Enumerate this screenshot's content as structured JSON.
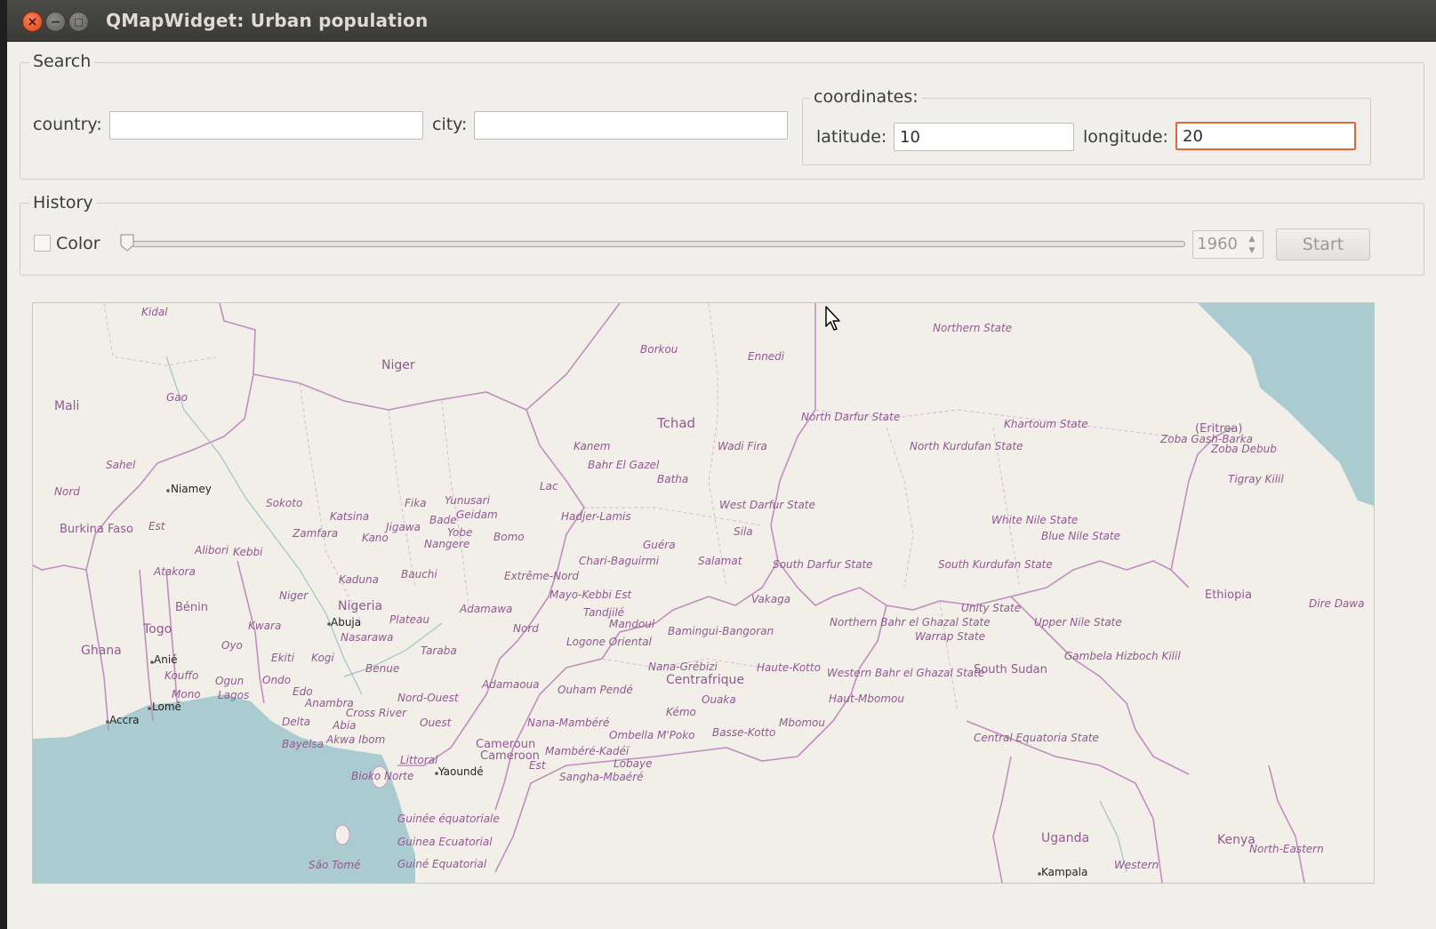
{
  "window": {
    "title": "QMapWidget: Urban population"
  },
  "search": {
    "group_title": "Search",
    "country_label": "country:",
    "country_value": "",
    "city_label": "city:",
    "city_value": "",
    "coordinates": {
      "group_title": "coordinates:",
      "latitude_label": "latitude:",
      "latitude_value": "10",
      "longitude_label": "longitude:",
      "longitude_value": "20"
    }
  },
  "history": {
    "group_title": "History",
    "color_label": "Color",
    "color_checked": false,
    "slider_fraction": 0,
    "year_value": "1960",
    "start_label": "Start"
  },
  "map": {
    "labels": [
      "Kidal",
      "Niger",
      "Borkou",
      "Ennedi",
      "Northern State",
      "Mali",
      "Gao",
      "Tchad",
      "North Darfur State",
      "Khartoum State",
      "Kanem",
      "Wadi Fira",
      "North Kurdufan State",
      "(Eritrea)",
      "Zoba Gash-Barka",
      "Zoba Debub",
      "Sahel",
      "Niamey",
      "Bahr El Gazel",
      "Batha",
      "Lac",
      "Tigray Kilil",
      "Nord",
      "Sokoto",
      "Katsina",
      "Fika",
      "Yunusari",
      "Geidam",
      "Burkina Faso",
      "Est",
      "Zamfara",
      "Jigawa",
      "Bade",
      "Yobe",
      "Hadjer-Lamis",
      "West Darfur State",
      "White Nile State",
      "Kano",
      "Nangere",
      "Bomo",
      "Guéra",
      "Sila",
      "Blue Nile State",
      "Alibori",
      "Kebbi",
      "Chari-Baguirmi",
      "Salamat",
      "South Darfur State",
      "South Kurdufan State",
      "Atakora",
      "Bauchi",
      "Extrême-Nord",
      "Kaduna",
      "Niger",
      "Mayo-Kebbi Est",
      "Vakaga",
      "Ethiopia",
      "Bénin",
      "Nigeria",
      "Tandjilé",
      "Adamawa",
      "Unity State",
      "Dire Dawa",
      "Abuja",
      "Plateau",
      "Mandoul",
      "Northern Bahr el Ghazal State",
      "Upper Nile State",
      "Togo",
      "Kwara",
      "Nord",
      "Bamingui-Bangoran",
      "Warrap State",
      "Ghana",
      "Oyo",
      "Nasarawa",
      "Taraba",
      "Logone Oriental",
      "Gambela Hizboch Kilil",
      "Anié",
      "Ekiti",
      "Kogi",
      "Benue",
      "Nana-Grébizi",
      "Haute-Kotto",
      "Western Bahr el Ghazal State",
      "South Sudan",
      "Kouffo",
      "Ogun",
      "Ondo",
      "Adamaoua",
      "Centrafrique",
      "Mono",
      "Lagos",
      "Edo",
      "Ouham Pendé",
      "Nord-Ouest",
      "Ouaka",
      "Haut-Mbomou",
      "Lomé",
      "Anambra",
      "Kémo",
      "Mbomou",
      "Accra",
      "Cross River",
      "Nana-Mambéré",
      "Ouest",
      "Ombella M'Poko",
      "Basse-Kotto",
      "Central Equatoria State",
      "Delta",
      "Abia",
      "Bayelsa",
      "Akwa Ibom",
      "Cameroun",
      "Cameroon",
      "Mambéré-Kadéï",
      "Littoral",
      "Est",
      "Lobaye",
      "Bioko Norte",
      "Yaoundé",
      "Sangha-Mbaéré",
      "Guinée équatoriale",
      "Guinea Ecuatorial",
      "Guiné Equatorial",
      "Uganda",
      "Kenya",
      "North-Eastern",
      "São Tomé",
      "Kampala",
      "Western"
    ]
  }
}
